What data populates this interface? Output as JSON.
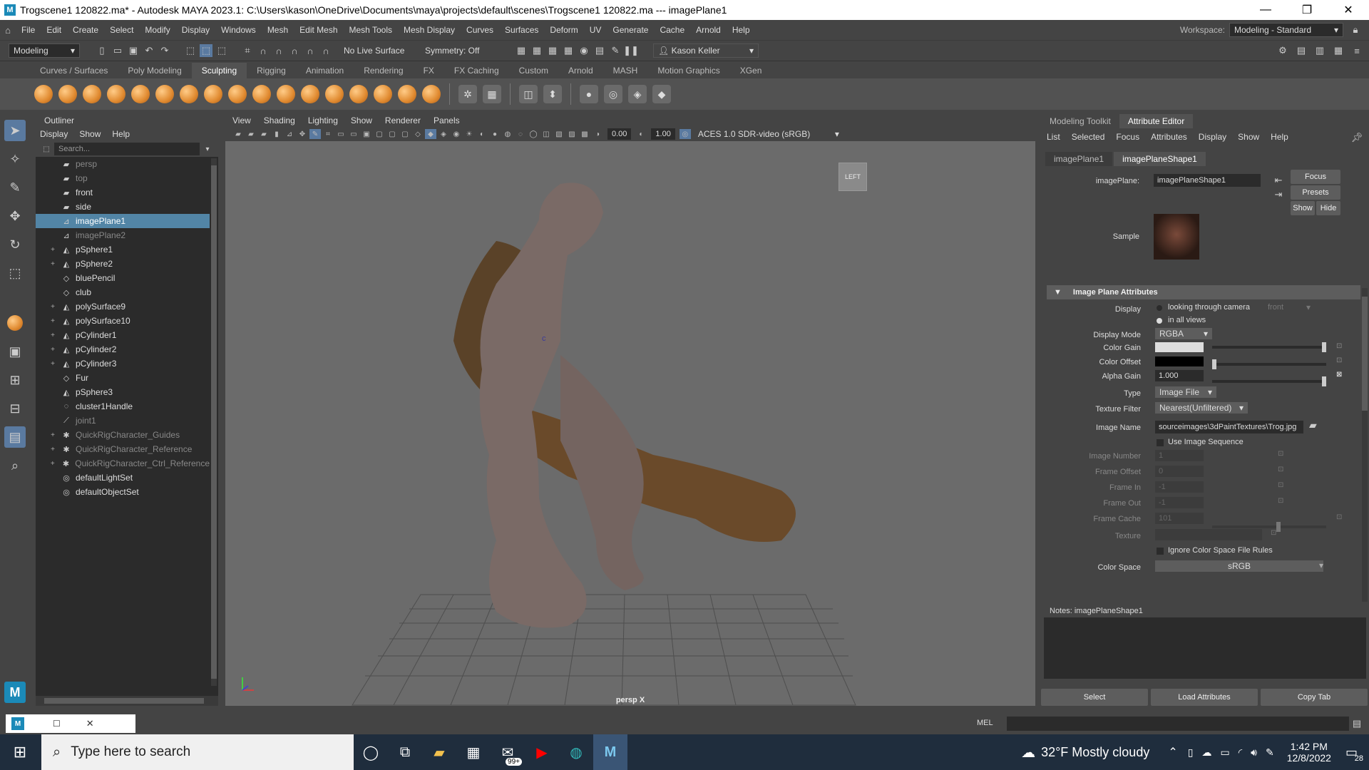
{
  "window": {
    "title": "Trogscene1 120822.ma* - Autodesk MAYA 2023.1: C:\\Users\\kason\\OneDrive\\Documents\\maya\\projects\\default\\scenes\\Trogscene1 120822.ma    ---    imagePlane1",
    "minimize": "—",
    "restore": "❐",
    "close": "✕"
  },
  "menubar": {
    "items": [
      "File",
      "Edit",
      "Create",
      "Select",
      "Modify",
      "Display",
      "Windows",
      "Mesh",
      "Edit Mesh",
      "Mesh Tools",
      "Mesh Display",
      "Curves",
      "Surfaces",
      "Deform",
      "UV",
      "Generate",
      "Cache",
      "Arnold",
      "Help"
    ],
    "workspace_label": "Workspace:",
    "workspace_value": "Modeling - Standard"
  },
  "statusline": {
    "mode": "Modeling",
    "live_surface": "No Live Surface",
    "symmetry": "Symmetry: Off",
    "user": "Kason Keller"
  },
  "shelf": {
    "tabs": [
      "Curves / Surfaces",
      "Poly Modeling",
      "Sculpting",
      "Rigging",
      "Animation",
      "Rendering",
      "FX",
      "FX Caching",
      "Custom",
      "Arnold",
      "MASH",
      "Motion Graphics",
      "XGen"
    ],
    "active_tab": "Sculpting"
  },
  "outliner": {
    "title": "Outliner",
    "menu": [
      "Display",
      "Show",
      "Help"
    ],
    "search_placeholder": "Search...",
    "rows": [
      {
        "label": "persp",
        "dim": true,
        "expand": ""
      },
      {
        "label": "top",
        "dim": true,
        "expand": ""
      },
      {
        "label": "front",
        "dim": false,
        "expand": ""
      },
      {
        "label": "side",
        "dim": false,
        "expand": ""
      },
      {
        "label": "imagePlane1",
        "dim": false,
        "expand": "",
        "selected": true
      },
      {
        "label": "imagePlane2",
        "dim": true,
        "expand": ""
      },
      {
        "label": "pSphere1",
        "dim": false,
        "expand": "+"
      },
      {
        "label": "pSphere2",
        "dim": false,
        "expand": "+"
      },
      {
        "label": "bluePencil",
        "dim": false,
        "expand": ""
      },
      {
        "label": "club",
        "dim": false,
        "expand": ""
      },
      {
        "label": "polySurface9",
        "dim": false,
        "expand": "+"
      },
      {
        "label": "polySurface10",
        "dim": false,
        "expand": "+"
      },
      {
        "label": "pCylinder1",
        "dim": false,
        "expand": "+"
      },
      {
        "label": "pCylinder2",
        "dim": false,
        "expand": "+"
      },
      {
        "label": "pCylinder3",
        "dim": false,
        "expand": "+"
      },
      {
        "label": "Fur",
        "dim": false,
        "expand": ""
      },
      {
        "label": "pSphere3",
        "dim": false,
        "expand": ""
      },
      {
        "label": "cluster1Handle",
        "dim": false,
        "expand": ""
      },
      {
        "label": "joint1",
        "dim": true,
        "expand": ""
      },
      {
        "label": "QuickRigCharacter_Guides",
        "dim": true,
        "expand": "+"
      },
      {
        "label": "QuickRigCharacter_Reference",
        "dim": true,
        "expand": "+"
      },
      {
        "label": "QuickRigCharacter_Ctrl_Reference",
        "dim": true,
        "expand": "+"
      },
      {
        "label": "defaultLightSet",
        "dim": false,
        "expand": ""
      },
      {
        "label": "defaultObjectSet",
        "dim": false,
        "expand": ""
      }
    ]
  },
  "viewport": {
    "menu": [
      "View",
      "Shading",
      "Lighting",
      "Show",
      "Renderer",
      "Panels"
    ],
    "field1": "0.00",
    "field2": "1.00",
    "color_space": "ACES 1.0 SDR-video (sRGB)",
    "view_cube": "LEFT",
    "camera_label": "persp X"
  },
  "attribute_editor": {
    "top_tabs": [
      "Modeling Toolkit",
      "Attribute Editor"
    ],
    "active_top_tab": "Attribute Editor",
    "menu": [
      "List",
      "Selected",
      "Focus",
      "Attributes",
      "Display",
      "Show",
      "Help"
    ],
    "node_tabs": [
      "imagePlane1",
      "imagePlaneShape1"
    ],
    "active_node_tab": "imagePlaneShape1",
    "node_label": "imagePlane:",
    "node_value": "imagePlaneShape1",
    "focus_btn": "Focus",
    "presets_btn": "Presets",
    "show_btn": "Show",
    "hide_btn": "Hide",
    "sample_label": "Sample",
    "section_title": "Image Plane Attributes",
    "display_label": "Display",
    "display_opt1": "looking through camera",
    "display_opt1_camera": "front",
    "display_opt2": "in all views",
    "display_mode_label": "Display Mode",
    "display_mode_value": "RGBA",
    "color_gain_label": "Color Gain",
    "color_offset_label": "Color Offset",
    "alpha_gain_label": "Alpha Gain",
    "alpha_gain_value": "1.000",
    "type_label": "Type",
    "type_value": "Image File",
    "texture_filter_label": "Texture Filter",
    "texture_filter_value": "Nearest(Unfiltered)",
    "image_name_label": "Image Name",
    "image_name_value": "sourceimages\\3dPaintTextures\\Trog.jpg",
    "use_seq_label": "Use Image Sequence",
    "image_number_label": "Image Number",
    "image_number_value": "1",
    "frame_offset_label": "Frame Offset",
    "frame_offset_value": "0",
    "frame_in_label": "Frame In",
    "frame_in_value": "-1",
    "frame_out_label": "Frame Out",
    "frame_out_value": "-1",
    "frame_cache_label": "Frame Cache",
    "frame_cache_value": "101",
    "texture_label": "Texture",
    "ignore_cs_label": "Ignore Color Space File Rules",
    "color_space_label": "Color Space",
    "color_space_value": "sRGB",
    "notes_label": "Notes:  imagePlaneShape1",
    "bottom_select": "Select",
    "bottom_load": "Load Attributes",
    "bottom_copy": "Copy Tab"
  },
  "cmdline": {
    "lang": "MEL"
  },
  "taskbar": {
    "search_placeholder": "Type here to search",
    "mail_badge": "99+",
    "weather": "32°F  Mostly cloudy",
    "time": "1:42 PM",
    "date": "12/8/2022",
    "notif_count": "28"
  },
  "colors": {
    "selection": "#5285a6",
    "panel": "#444444",
    "viewport_bg": "#6b6b6b",
    "taskbar": "#1f2d3d"
  }
}
